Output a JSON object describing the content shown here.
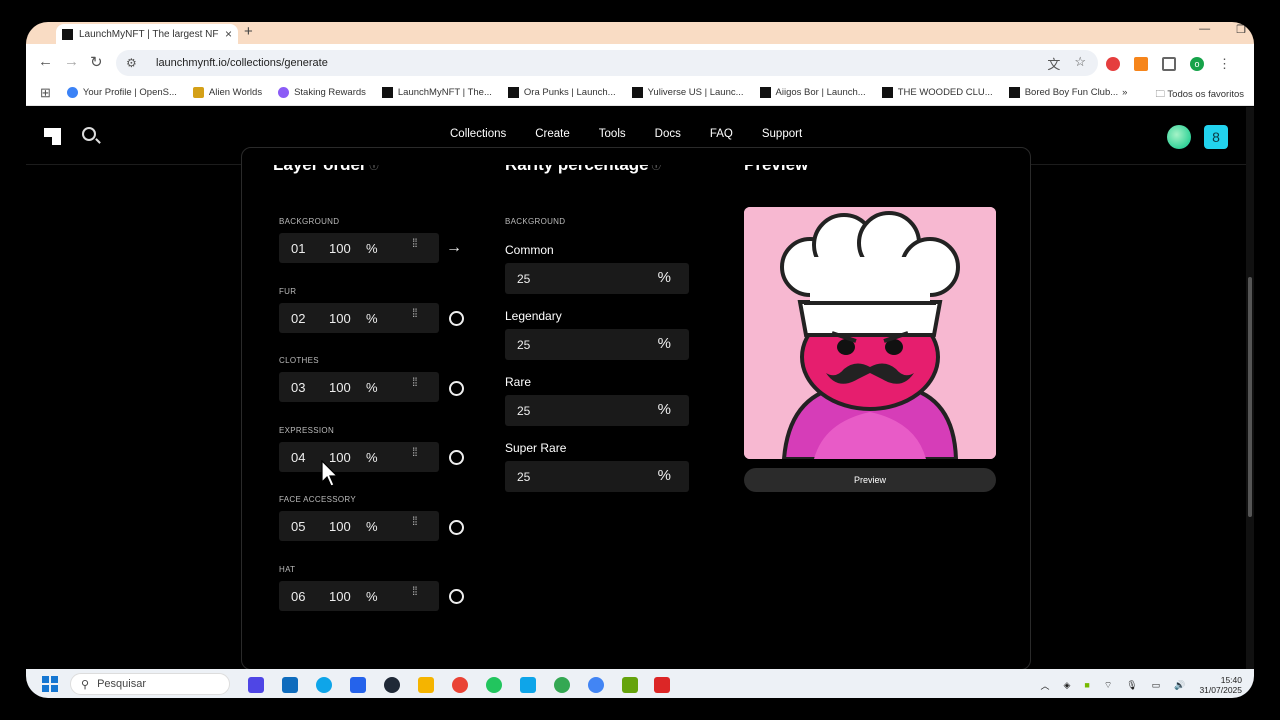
{
  "browser": {
    "tab_title": "LaunchMyNFT | The largest NF",
    "url": "launchmynft.io/collections/generate",
    "bookmarks": [
      "Your Profile | OpenS...",
      "Alien Worlds",
      "Staking Rewards",
      "LaunchMyNFT | The...",
      "Ora Punks | Launch...",
      "Yuliverse US | Launc...",
      "Aiigos Bor | Launch...",
      "THE WOODED CLU...",
      "Bored Boy Fun Club..."
    ],
    "all_bookmarks_label": "Todos os favoritos",
    "profile_initial": "o"
  },
  "site_nav": {
    "items": [
      "Collections",
      "Create",
      "Tools",
      "Docs",
      "FAQ",
      "Support"
    ],
    "badge_count": "8"
  },
  "layer_order": {
    "title": "Layer order",
    "info_icon": "info-icon",
    "layers": [
      {
        "name": "BACKGROUND",
        "index": "01",
        "percent": "100",
        "symbol": "%",
        "action": "arrow-right"
      },
      {
        "name": "FUR",
        "index": "02",
        "percent": "100",
        "symbol": "%",
        "action": "circle"
      },
      {
        "name": "CLOTHES",
        "index": "03",
        "percent": "100",
        "symbol": "%",
        "action": "circle"
      },
      {
        "name": "EXPRESSION",
        "index": "04",
        "percent": "100",
        "symbol": "%",
        "action": "circle"
      },
      {
        "name": "FACE ACCESSORY",
        "index": "05",
        "percent": "100",
        "symbol": "%",
        "action": "circle"
      },
      {
        "name": "HAT",
        "index": "06",
        "percent": "100",
        "symbol": "%",
        "action": "circle"
      }
    ]
  },
  "rarity": {
    "title": "Rarity percentage",
    "layer_name": "BACKGROUND",
    "tiers": [
      {
        "label": "Common",
        "value": "25",
        "symbol": "%"
      },
      {
        "label": "Legendary",
        "value": "25",
        "symbol": "%"
      },
      {
        "label": "Rare",
        "value": "25",
        "symbol": "%"
      },
      {
        "label": "Super Rare",
        "value": "25",
        "symbol": "%"
      }
    ]
  },
  "preview": {
    "title": "Preview",
    "button_label": "Preview"
  },
  "taskbar": {
    "search_placeholder": "Pesquisar",
    "time": "15:40",
    "date": "31/07/2025"
  }
}
